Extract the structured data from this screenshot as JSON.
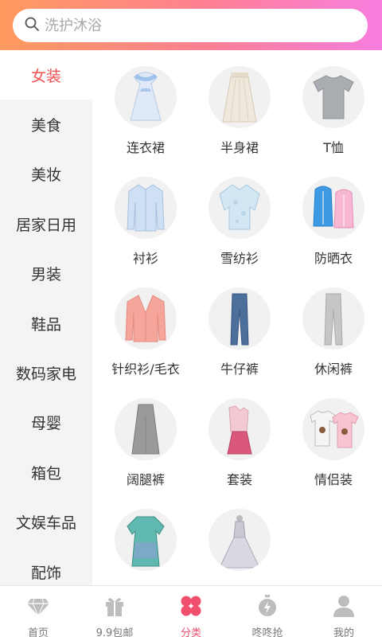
{
  "search": {
    "placeholder": "洗护沐浴"
  },
  "sidebar": {
    "items": [
      {
        "label": "女装",
        "active": true
      },
      {
        "label": "美食"
      },
      {
        "label": "美妆"
      },
      {
        "label": "居家日用"
      },
      {
        "label": "男装"
      },
      {
        "label": "鞋品"
      },
      {
        "label": "数码家电"
      },
      {
        "label": "母婴"
      },
      {
        "label": "箱包"
      },
      {
        "label": "文娱车品"
      },
      {
        "label": "配饰"
      }
    ]
  },
  "grid": {
    "items": [
      {
        "label": "连衣裙",
        "icon": "dress-icon"
      },
      {
        "label": "半身裙",
        "icon": "skirt-icon"
      },
      {
        "label": "T恤",
        "icon": "tshirt-icon"
      },
      {
        "label": "衬衫",
        "icon": "shirt-icon"
      },
      {
        "label": "雪纺衫",
        "icon": "chiffon-blouse-icon"
      },
      {
        "label": "防晒衣",
        "icon": "sun-jacket-icon"
      },
      {
        "label": "针织衫/毛衣",
        "icon": "cardigan-icon"
      },
      {
        "label": "牛仔裤",
        "icon": "jeans-icon"
      },
      {
        "label": "休闲裤",
        "icon": "casual-pants-icon"
      },
      {
        "label": "阔腿裤",
        "icon": "wide-leg-pants-icon"
      },
      {
        "label": "套装",
        "icon": "outfit-set-icon"
      },
      {
        "label": "情侣装",
        "icon": "couple-tshirts-icon"
      },
      {
        "label": "",
        "icon": "print-dress-icon"
      },
      {
        "label": "",
        "icon": "gown-icon"
      }
    ]
  },
  "tabbar": {
    "items": [
      {
        "label": "首页",
        "icon": "diamond-icon"
      },
      {
        "label": "9.9包邮",
        "icon": "gift-icon"
      },
      {
        "label": "分类",
        "icon": "category-icon",
        "active": true
      },
      {
        "label": "咚咚抢",
        "icon": "stopwatch-icon"
      },
      {
        "label": "我的",
        "icon": "user-icon"
      }
    ]
  },
  "colors": {
    "accent": "#f24f4f",
    "tab_active": "#f0506e",
    "header_start": "#ff9a5e",
    "header_end": "#f77ee0"
  }
}
